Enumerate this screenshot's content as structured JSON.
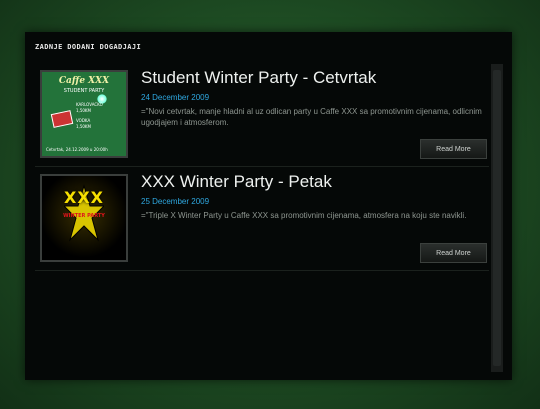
{
  "panel": {
    "title": "ZADNJE DODANI DOGADJAJI"
  },
  "items": [
    {
      "title": "Student Winter Party - Cetvrtak",
      "date": "24 December 2009",
      "description": "=\"Novi cetvrtak, manje hladni al uz odlican party u Caffe XXX sa promotivnim cijenama, odlicnim ugodjajem i atmosferom.",
      "read_more": "Read More",
      "poster": {
        "brand": "Caffe XXX",
        "subtitle": "STUDENT PARTY",
        "lines": [
          "KARLOVACKO",
          "1,50KM",
          "VODKA",
          "1,50KM"
        ],
        "footer": "Cetvrtak, 24.12.2009 u 20:00h"
      }
    },
    {
      "title": "XXX Winter Party - Petak",
      "date": "25 December 2009",
      "description": "=\"Triple X Winter Party u Caffe XXX sa promotivnim cijenama, atmosfera na koju ste navikli.",
      "read_more": "Read More",
      "poster": {
        "logo": "XXX",
        "caption": "WINTER PARTY"
      }
    }
  ],
  "colors": {
    "accent_date": "#2fa8e0",
    "background": "#1d4a22",
    "panel": "#050807"
  }
}
